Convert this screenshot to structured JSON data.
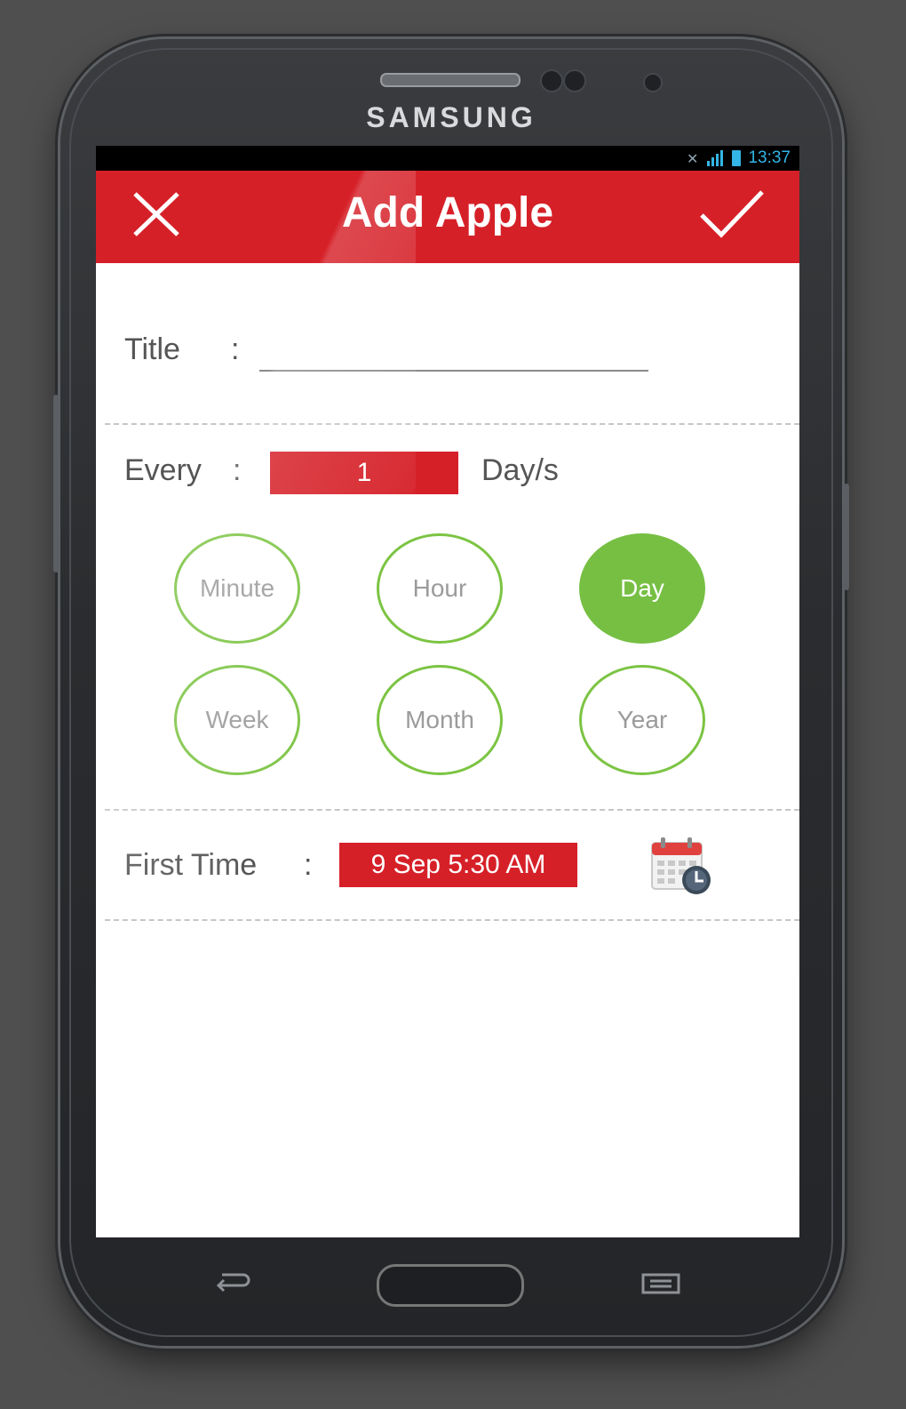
{
  "device": {
    "brand": "SAMSUNG"
  },
  "statusbar": {
    "time": "13:37"
  },
  "appbar": {
    "title": "Add Apple",
    "close_icon": "close-icon",
    "confirm_icon": "check-icon"
  },
  "form": {
    "title_label": "Title",
    "title_colon": ":",
    "title_value": "",
    "every_label": "Every",
    "every_colon": ":",
    "every_value": "1",
    "every_unit": "Day/s",
    "periods": [
      "Minute",
      "Hour",
      "Day",
      "Week",
      "Month",
      "Year"
    ],
    "selected_period": "Day",
    "first_time_label": "First Time",
    "first_time_colon": ":",
    "first_time_value": "9 Sep 5:30 AM",
    "calendar_icon": "calendar-clock-icon"
  },
  "colors": {
    "accent_red": "#d62028",
    "accent_green": "#76bf43",
    "status_blue": "#33b5e5"
  }
}
